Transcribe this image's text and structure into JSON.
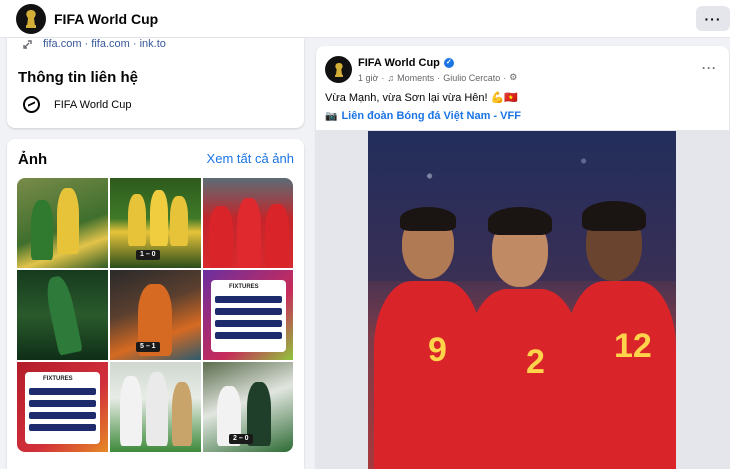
{
  "topbar": {
    "page_name": "FIFA World Cup",
    "more_label": "···"
  },
  "contact": {
    "links": "fifa.com · fifa.com · ink.to",
    "title": "Thông tin liên hệ",
    "messenger_name": "FIFA World Cup"
  },
  "photos": {
    "title": "Ảnh",
    "see_all": "Xem tất cả ảnh",
    "fixtures_label": "FIXTURES",
    "scores": [
      "1 – 0",
      "5 – 1",
      "2 – 0"
    ]
  },
  "post": {
    "author": "FIFA World Cup",
    "time": "1 giờ",
    "dot": "·",
    "moments": "Moments",
    "with_person": "Giulio Cercato",
    "text": "Vừa Mạnh, vừa Sơn lại vừa Hên! 💪🇻🇳",
    "tag": "Liên đoàn Bóng đá Việt Nam - VFF",
    "more_label": "···",
    "jersey_numbers": [
      "9",
      "2",
      "12"
    ]
  },
  "colors": {
    "link": "#1b74e4",
    "jersey": "#d9242a",
    "jersey_number": "#ffd34a"
  }
}
